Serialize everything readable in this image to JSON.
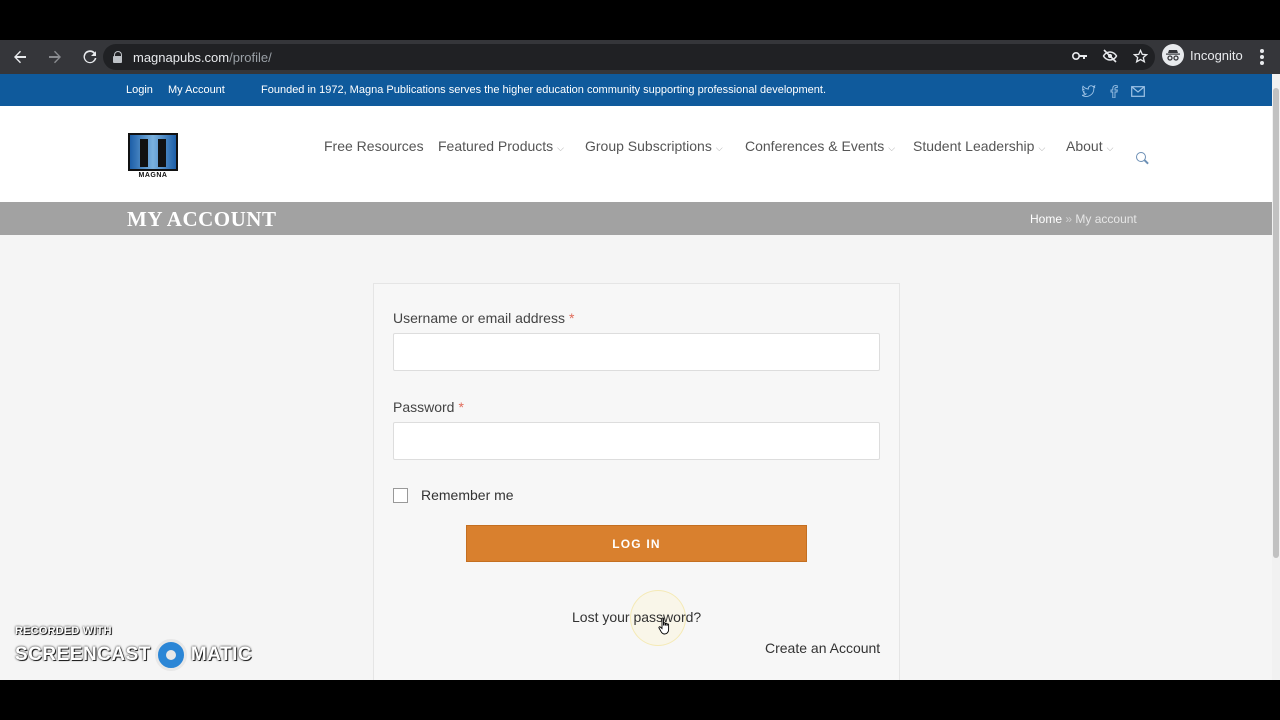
{
  "browser": {
    "url_host": "magnapubs.com",
    "url_path": "/profile/",
    "profile_label": "Incognito",
    "icons": [
      "back-arrow-icon",
      "forward-arrow-icon",
      "reload-icon",
      "lock-icon",
      "key-icon",
      "eye-off-icon",
      "star-icon",
      "incognito-icon",
      "menu-dots-icon"
    ]
  },
  "topbar": {
    "login": "Login",
    "my_account": "My Account",
    "tagline": "Founded in 1972, Magna Publications serves the higher education community supporting professional development.",
    "social_icons": [
      "twitter-icon",
      "facebook-icon",
      "mail-icon"
    ],
    "bg_color": "#0f5a9c"
  },
  "header": {
    "logo_text": "MAGNA",
    "nav": [
      {
        "label": "Free Resources",
        "has_dropdown": false
      },
      {
        "label": "Featured Products",
        "has_dropdown": true
      },
      {
        "label": "Group Subscriptions",
        "has_dropdown": true
      },
      {
        "label": "Conferences & Events",
        "has_dropdown": true
      },
      {
        "label": "Student Leadership",
        "has_dropdown": true
      },
      {
        "label": "About",
        "has_dropdown": true
      }
    ],
    "chevron": "⌵"
  },
  "titlebar": {
    "title": "MY ACCOUNT",
    "breadcrumb_home": "Home",
    "breadcrumb_sep": "»",
    "breadcrumb_current": "My account"
  },
  "login_form": {
    "username_label": "Username or email address",
    "password_label": "Password",
    "required_mark": "*",
    "username_value": "",
    "password_value": "",
    "remember_label": "Remember me",
    "remember_checked": false,
    "submit_label": "LOG IN",
    "lost_password": "Lost your password?",
    "create_account": "Create an Account",
    "accent_color": "#d9802e"
  },
  "watermark": {
    "line1": "RECORDED WITH",
    "left": "SCREENCAST",
    "right": "MATIC"
  }
}
